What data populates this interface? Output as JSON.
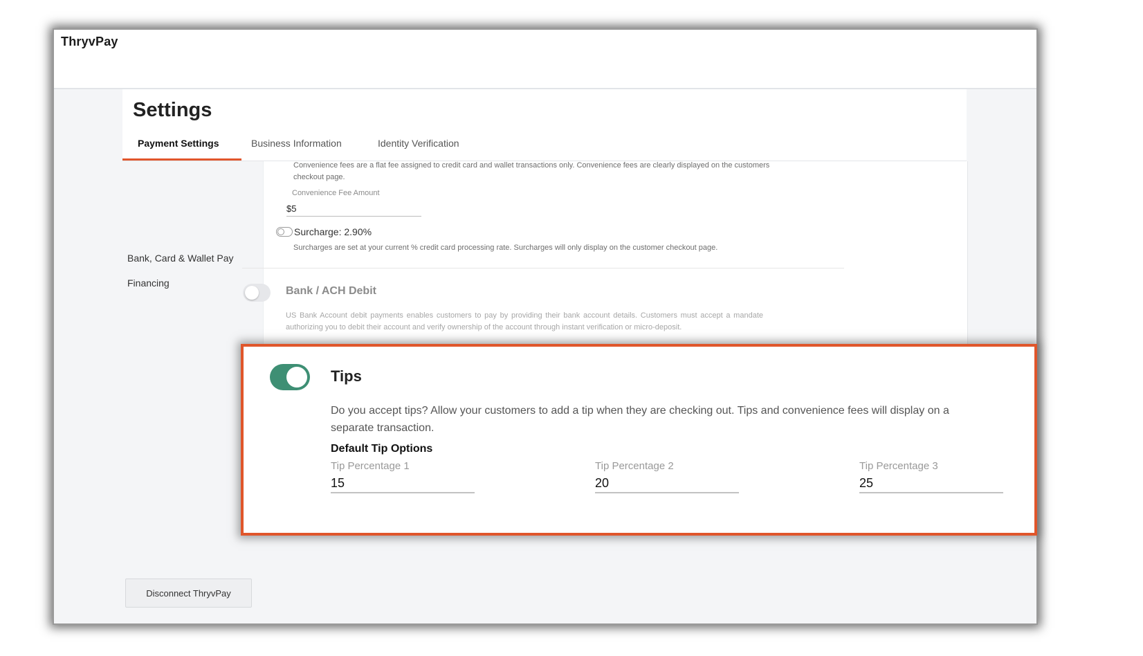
{
  "app": {
    "brand": "ThryvPay"
  },
  "settings": {
    "title": "Settings",
    "tabs": [
      {
        "label": "Payment Settings",
        "active": true
      },
      {
        "label": "Business Information",
        "active": false
      },
      {
        "label": "Identity Verification",
        "active": false
      }
    ]
  },
  "sidebar": {
    "items": [
      {
        "label": "Bank, Card & Wallet Pay"
      },
      {
        "label": "Financing"
      }
    ]
  },
  "convenience": {
    "description": "Convenience fees are a flat fee assigned to credit card and wallet transactions only. Convenience fees are clearly displayed on the customers checkout page.",
    "fee_label": "Convenience Fee Amount",
    "fee_value": "$5"
  },
  "surcharge": {
    "title": "Surcharge: 2.90%",
    "enabled": false,
    "description": "Surcharges are set at your current % credit card processing rate. Surcharges will only display on the customer checkout page."
  },
  "ach": {
    "title": "Bank / ACH Debit",
    "enabled": false,
    "description": "US Bank Account debit payments enables customers to pay by providing their bank account details. Customers must accept a mandate authorizing you to debit their account and verify ownership of the account through instant verification or micro-deposit."
  },
  "tips": {
    "title": "Tips",
    "enabled": true,
    "description": "Do you accept tips? Allow your customers to add a tip when they are checking out. Tips and convenience fees will display on a separate transaction.",
    "default_options_label": "Default Tip Options",
    "fields": [
      {
        "label": "Tip Percentage 1",
        "value": "15"
      },
      {
        "label": "Tip Percentage 2",
        "value": "20"
      },
      {
        "label": "Tip Percentage 3",
        "value": "25"
      }
    ]
  },
  "actions": {
    "disconnect_label": "Disconnect ThryvPay"
  },
  "colors": {
    "accent": "#e1562c",
    "toggle_on": "#3e8f74",
    "callout_border": "#e0562b"
  }
}
